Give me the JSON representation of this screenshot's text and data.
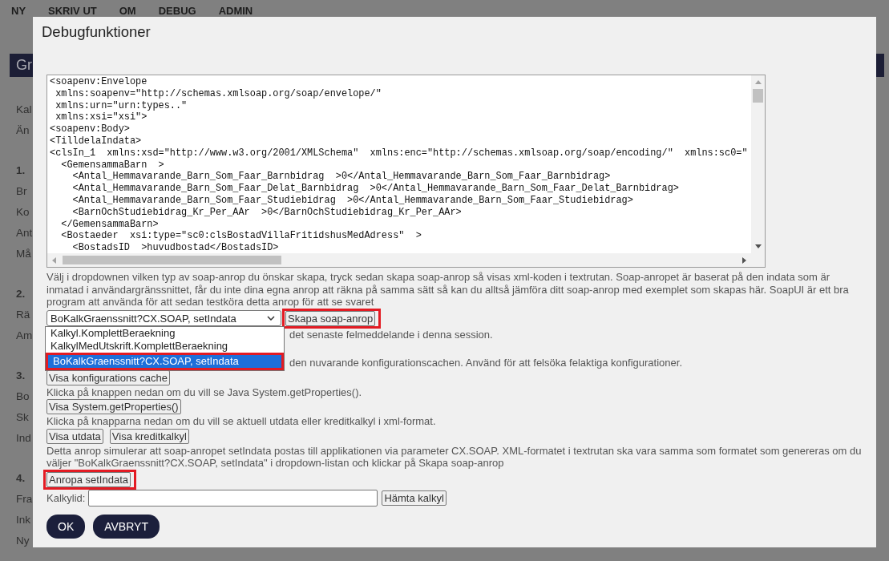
{
  "background": {
    "nav": [
      "NY",
      "SKRIV UT",
      "OM",
      "DEBUG",
      "ADMIN"
    ],
    "left_panel": {
      "title": "Gr",
      "sections": [
        {
          "items": [
            "Kal",
            "Än"
          ]
        },
        {
          "heading": "1.",
          "items": [
            "Br",
            "Ko",
            "Ant",
            "Må"
          ]
        },
        {
          "heading": "2.",
          "items": [
            "Rä",
            "Am"
          ]
        },
        {
          "heading": "3.",
          "items": [
            "Bo",
            "Sk",
            "Ind"
          ]
        },
        {
          "heading": "4.",
          "items": [
            "Fra",
            "Ink",
            "Ny"
          ]
        }
      ]
    }
  },
  "dialog": {
    "title": "Debugfunktioner",
    "xml_text": "<soapenv:Envelope\n xmlns:soapenv=\"http://schemas.xmlsoap.org/soap/envelope/\"\n xmlns:urn=\"urn:types..\"\n xmlns:xsi=\"xsi\">\n<soapenv:Body>\n<TilldelaIndata>\n<clsIn_1  xmlns:xsd=\"http://www.w3.org/2001/XMLSchema\"  xmlns:enc=\"http://schemas.xmlsoap.org/soap/encoding/\"  xmlns:sc0=\"\n  <GemensammaBarn  >\n    <Antal_Hemmavarande_Barn_Som_Faar_Barnbidrag  >0</Antal_Hemmavarande_Barn_Som_Faar_Barnbidrag>\n    <Antal_Hemmavarande_Barn_Som_Faar_Delat_Barnbidrag  >0</Antal_Hemmavarande_Barn_Som_Faar_Delat_Barnbidrag>\n    <Antal_Hemmavarande_Barn_Som_Faar_Studiebidrag  >0</Antal_Hemmavarande_Barn_Som_Faar_Studiebidrag>\n    <BarnOchStudiebidrag_Kr_Per_AAr  >0</BarnOchStudiebidrag_Kr_Per_AAr>\n  </GemensammaBarn>\n  <Bostaeder  xsi:type=\"sc0:clsBostadVillaFritidshusMedAdress\"  >\n    <BostadsID  >huvudbostad</BostadsID>",
    "intro": "Välj i dropdownen vilken typ av soap-anrop du önskar skapa, tryck sedan skapa soap-anrop så visas xml-koden i textrutan. Soap-anropet är baserat på den indata som är inmatad i användargränssnittet, får du inte dina egna anrop att räkna på samma sätt så kan du alltså jämföra ditt soap-anrop med exemplet som skapas här. SoapUI är ett bra program att använda för att sedan testköra detta anrop för att se svaret",
    "soap_select": {
      "value": "BoKalkGraenssnitt?CX.SOAP, setIndata",
      "open": true,
      "options": [
        {
          "label": "Kalkyl.KomplettBeraekning",
          "selected": false,
          "highlighted": false
        },
        {
          "label": "KalkylMedUtskrift.KomplettBeraekning",
          "selected": false,
          "highlighted": false
        },
        {
          "label": "BoKalkGraenssnitt?CX.SOAP, setIndata",
          "selected": true,
          "highlighted": true
        }
      ]
    },
    "create_button": {
      "label": "Skapa soap-anrop",
      "highlighted": true
    },
    "beside_list": [
      "det senaste felmeddelande i denna session.",
      "den nuvarande konfigurationscachen. Använd för att felsöka felaktiga konfigurationer."
    ],
    "blocks": [
      {
        "kind": "buttons",
        "buttons": [
          {
            "label": "Visa konfigurations cache",
            "highlighted": false
          }
        ]
      },
      {
        "kind": "text",
        "text": "Klicka på knappen nedan om du vill se Java System.getProperties()."
      },
      {
        "kind": "buttons",
        "buttons": [
          {
            "label": "Visa System.getProperties()",
            "highlighted": false
          }
        ]
      },
      {
        "kind": "text",
        "text": "Klicka på knapparna nedan om du vill se aktuell utdata eller kreditkalkyl i xml-format."
      },
      {
        "kind": "buttons",
        "buttons": [
          {
            "label": "Visa utdata",
            "highlighted": false
          },
          {
            "label": "Visa kreditkalkyl",
            "highlighted": false
          }
        ]
      },
      {
        "kind": "text",
        "text": "Detta anrop simulerar att soap-anropet setIndata postas till applikationen via parameter CX.SOAP. XML-formatet i textrutan ska vara samma som formatet som genereras om du väljer \"BoKalkGraenssnitt?CX.SOAP, setIndata\" i dropdown-listan och klickar på Skapa soap-anrop"
      },
      {
        "kind": "buttons",
        "buttons": [
          {
            "label": "Anropa setIndata",
            "highlighted": true
          }
        ]
      },
      {
        "kind": "field",
        "label": "Kalkylid:",
        "button": {
          "label": "Hämta kalkyl",
          "highlighted": false
        }
      }
    ],
    "footer_buttons": [
      "OK",
      "AVBRYT"
    ]
  }
}
